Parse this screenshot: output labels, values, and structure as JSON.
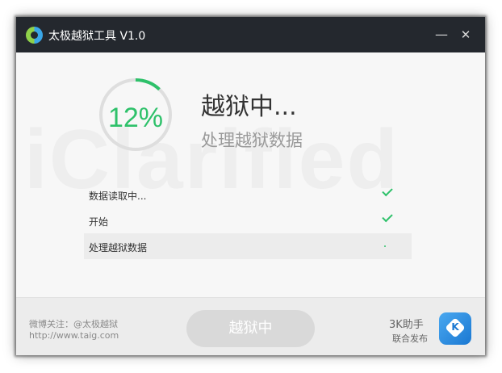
{
  "window": {
    "title": "太极越狱工具 V1.0",
    "minimize_glyph": "—",
    "close_glyph": "✕"
  },
  "watermark": "iClarified",
  "progress": {
    "percent_label": "12%",
    "value": 0.12,
    "color": "#2ec16a"
  },
  "status": {
    "title": "越狱中...",
    "subtitle": "处理越狱数据"
  },
  "steps": [
    {
      "label": "数据读取中...",
      "state": "done",
      "icon": "check-icon"
    },
    {
      "label": "开始",
      "state": "done",
      "icon": "check-icon"
    },
    {
      "label": "处理越狱数据",
      "state": "in-progress",
      "icon": "spinner-icon"
    }
  ],
  "footer": {
    "weibo": "微博关注：@太极越狱",
    "website": "http://www.taig.com",
    "button_label": "越狱中",
    "partner_name": "3K助手",
    "partner_sub": "联合发布"
  }
}
